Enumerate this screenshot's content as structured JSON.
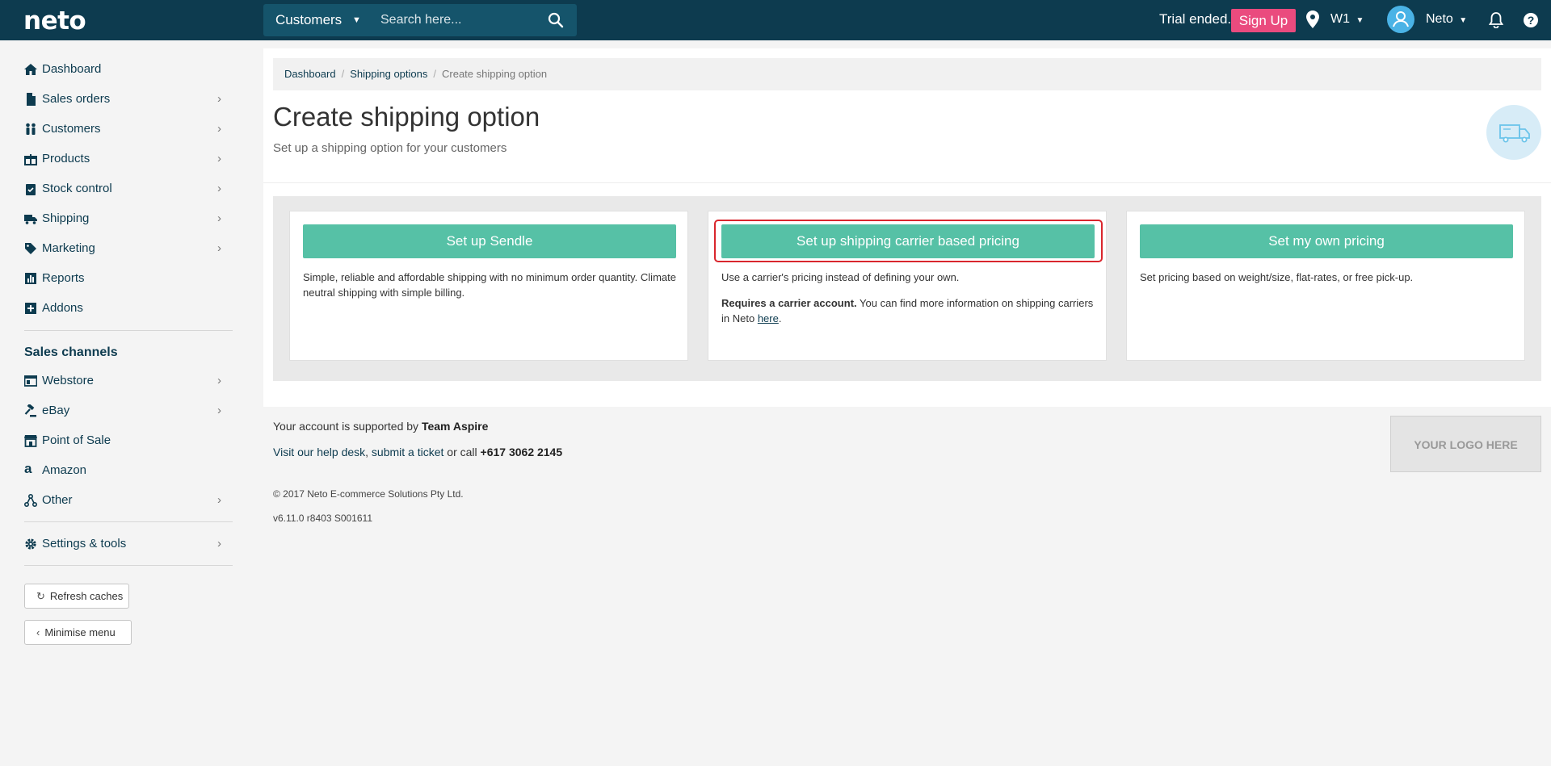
{
  "topbar": {
    "logo": "neto",
    "search_scope": "Customers",
    "search_placeholder": "Search here...",
    "trial_text": "Trial ended.",
    "signup_label": "Sign Up",
    "location": "W1",
    "user_name": "Neto"
  },
  "sidebar": {
    "items": [
      {
        "label": "Dashboard",
        "icon": "home-icon"
      },
      {
        "label": "Sales orders",
        "icon": "document-icon"
      },
      {
        "label": "Customers",
        "icon": "people-icon"
      },
      {
        "label": "Products",
        "icon": "gift-icon"
      },
      {
        "label": "Stock control",
        "icon": "clipboard-icon"
      },
      {
        "label": "Shipping",
        "icon": "truck-icon"
      },
      {
        "label": "Marketing",
        "icon": "tag-icon"
      },
      {
        "label": "Reports",
        "icon": "bar-chart-icon"
      },
      {
        "label": "Addons",
        "icon": "plus-square-icon"
      }
    ],
    "channels_title": "Sales channels",
    "channels": [
      {
        "label": "Webstore",
        "icon": "webstore-icon"
      },
      {
        "label": "eBay",
        "icon": "gavel-icon"
      },
      {
        "label": "Point of Sale",
        "icon": "store-icon"
      },
      {
        "label": "Amazon",
        "icon": "amazon-icon"
      },
      {
        "label": "Other",
        "icon": "network-icon"
      }
    ],
    "settings": {
      "label": "Settings & tools",
      "icon": "gear-icon"
    },
    "refresh_label": "Refresh caches",
    "minimise_label": "Minimise menu"
  },
  "breadcrumb": {
    "items": [
      "Dashboard",
      "Shipping options"
    ],
    "current": "Create shipping option"
  },
  "page": {
    "title": "Create shipping option",
    "subtitle": "Set up a shipping option for your customers"
  },
  "cards": [
    {
      "button": "Set up Sendle",
      "description": "Simple, reliable and affordable shipping with no minimum order quantity. Climate neutral shipping with simple billing."
    },
    {
      "button": "Set up shipping carrier based pricing",
      "description": "Use a carrier's pricing instead of defining your own.",
      "requires_bold": "Requires a carrier account.",
      "requires_text": " You can find more information on shipping carriers in Neto ",
      "link": "here",
      "tail": "."
    },
    {
      "button": "Set my own pricing",
      "description": "Set pricing based on weight/size, flat-rates, or free pick-up."
    }
  ],
  "footer": {
    "supported_text": "Your account is supported by ",
    "team": "Team Aspire",
    "help_link": "Visit our help desk",
    "help_sep": ", ",
    "ticket_link": "submit a ticket",
    "call_text": " or call ",
    "phone": "+617 3062 2145",
    "copyright": "© 2017 Neto E-commerce Solutions Pty Ltd.",
    "version": "v6.11.0 r8403 S001611",
    "logo_placeholder": "YOUR LOGO HERE"
  },
  "colors": {
    "topbar": "#0d3b4f",
    "accent_green": "#56c1a6",
    "signup_pink": "#ea4b7e",
    "highlight_red": "#d9262d"
  }
}
